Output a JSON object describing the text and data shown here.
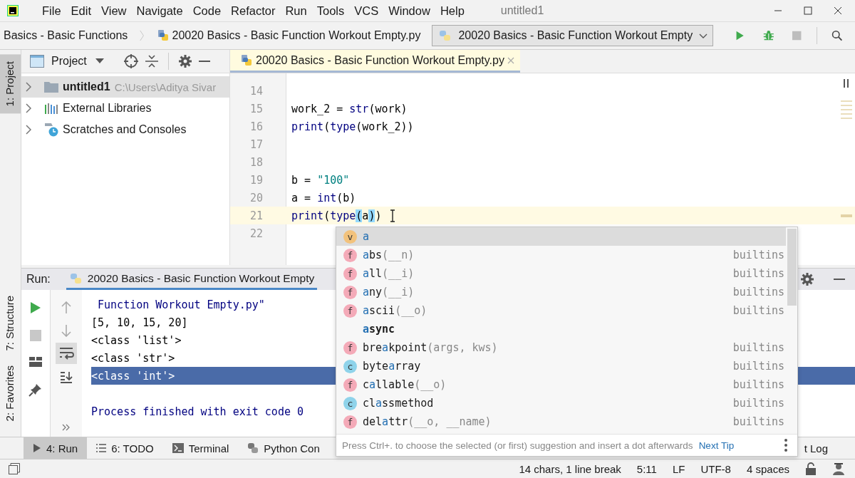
{
  "window": {
    "title": "untitled1"
  },
  "menu": [
    "File",
    "Edit",
    "View",
    "Navigate",
    "Code",
    "Refactor",
    "Run",
    "Tools",
    "VCS",
    "Window",
    "Help"
  ],
  "breadcrumbs": [
    "Basics - Basic Functions",
    "20020 Basics - Basic Function Workout Empty.py"
  ],
  "run_config": {
    "label": "20020 Basics - Basic Function Workout Empty"
  },
  "left_stripe": [
    {
      "label": "1: Project",
      "selected": true
    },
    {
      "label": "7: Structure",
      "selected": false
    },
    {
      "label": "2: Favorites",
      "selected": false
    }
  ],
  "project_panel": {
    "title": "Project",
    "tree": [
      {
        "kind": "project",
        "label": "untitled1",
        "path": "C:\\Users\\Aditya Sivar",
        "selected": true
      },
      {
        "kind": "libraries",
        "label": "External Libraries",
        "selected": false
      },
      {
        "kind": "scratches",
        "label": "Scratches and Consoles",
        "selected": false
      }
    ]
  },
  "editor": {
    "tabs": [
      {
        "label": "20020 Basics - Basic Function Workout Empty.py",
        "selected": true
      }
    ],
    "lines": [
      {
        "number": "14",
        "current": false
      },
      {
        "number": "15",
        "current": false,
        "tokens": [
          {
            "text": "work_2 = ",
            "kind": "plain"
          },
          {
            "text": "str",
            "kind": "builtin"
          },
          {
            "text": "(work)",
            "kind": "plain"
          }
        ]
      },
      {
        "number": "16",
        "current": false,
        "tokens": [
          {
            "text": "print",
            "kind": "builtin"
          },
          {
            "text": "(",
            "kind": "plain"
          },
          {
            "text": "type",
            "kind": "builtin"
          },
          {
            "text": "(work_2))",
            "kind": "plain"
          }
        ]
      },
      {
        "number": "17",
        "current": false
      },
      {
        "number": "18",
        "current": false
      },
      {
        "number": "19",
        "current": false,
        "tokens": [
          {
            "text": "b = ",
            "kind": "plain"
          },
          {
            "text": "\"100\"",
            "kind": "string"
          }
        ]
      },
      {
        "number": "20",
        "current": false,
        "tokens": [
          {
            "text": "a = ",
            "kind": "plain"
          },
          {
            "text": "int",
            "kind": "builtin"
          },
          {
            "text": "(b)",
            "kind": "plain"
          }
        ]
      },
      {
        "number": "21",
        "current": true,
        "tokens": [
          {
            "text": "print",
            "kind": "builtin"
          },
          {
            "text": "(",
            "kind": "plain"
          },
          {
            "text": "type",
            "kind": "builtin"
          },
          {
            "text": "(",
            "kind": "match"
          },
          {
            "text": "a",
            "kind": "plain"
          },
          {
            "text": ")",
            "kind": "match"
          },
          {
            "text": ")",
            "kind": "plain"
          }
        ]
      },
      {
        "number": "22",
        "current": false
      }
    ]
  },
  "run_panel": {
    "title": "Run:",
    "tab": "20020 Basics - Basic Function Workout Empty",
    "output": [
      {
        "text": " Function Workout Empty.py\"",
        "kind": "path",
        "selected": false
      },
      {
        "text": "[5, 10, 15, 20]",
        "kind": "plain",
        "selected": false
      },
      {
        "text": "<class 'list'>",
        "kind": "plain",
        "selected": false
      },
      {
        "text": "<class 'str'>",
        "kind": "plain",
        "selected": false
      },
      {
        "text": "<class 'int'>",
        "kind": "plain",
        "selected": true
      },
      {
        "kind": "blank",
        "selected": false
      },
      {
        "text": "Process finished with exit code 0",
        "kind": "info",
        "selected": false
      }
    ]
  },
  "bottom_tabs": [
    {
      "label": "4: Run",
      "kind": "run",
      "selected": true
    },
    {
      "label": "6: TODO",
      "kind": "todo",
      "selected": false
    },
    {
      "label": "Terminal",
      "kind": "terminal",
      "selected": false
    },
    {
      "label": "Python Con",
      "kind": "python",
      "selected": false
    }
  ],
  "bottom_tabs_right": [
    {
      "label": "t Log",
      "selected": false
    }
  ],
  "status_bar": [
    "14 chars, 1 line break",
    "5:11",
    "LF",
    "UTF-8",
    "4 spaces"
  ],
  "completion": {
    "items": [
      {
        "kind": "variable",
        "badge": "v",
        "hit": "a",
        "selected": true
      },
      {
        "kind": "function",
        "badge": "f",
        "hit": "a",
        "post": "bs",
        "params": "(__n)",
        "source": "builtins",
        "selected": false
      },
      {
        "kind": "function",
        "badge": "f",
        "hit": "a",
        "post": "ll",
        "params": "(__i)",
        "source": "builtins",
        "selected": false
      },
      {
        "kind": "function",
        "badge": "f",
        "hit": "a",
        "post": "ny",
        "params": "(__i)",
        "source": "builtins",
        "selected": false
      },
      {
        "kind": "function",
        "badge": "f",
        "hit": "a",
        "post": "scii",
        "params": "(__o)",
        "source": "builtins",
        "selected": false
      },
      {
        "kind": "keyword",
        "hit": "a",
        "post": "sync",
        "selected": false
      },
      {
        "kind": "function",
        "badge": "f",
        "pre": "bre",
        "hit": "a",
        "post": "kpoint",
        "params": "(args, kws)",
        "source": "builtins",
        "selected": false
      },
      {
        "kind": "class",
        "badge": "c",
        "pre": "byte",
        "hit": "a",
        "post": "rray",
        "source": "builtins",
        "selected": false
      },
      {
        "kind": "function",
        "badge": "f",
        "pre": "c",
        "hit": "a",
        "post": "llable",
        "params": "(__o)",
        "source": "builtins",
        "selected": false
      },
      {
        "kind": "class",
        "badge": "c",
        "pre": "cl",
        "hit": "a",
        "post": "ssmethod",
        "source": "builtins",
        "selected": false
      },
      {
        "kind": "function",
        "badge": "f",
        "pre": "del",
        "hit": "a",
        "post": "ttr",
        "params": "(__o, __name)",
        "source": "builtins",
        "selected": false
      }
    ],
    "hint": "Press Ctrl+. to choose the selected (or first) suggestion and insert a dot afterwards",
    "link": "Next Tip"
  }
}
